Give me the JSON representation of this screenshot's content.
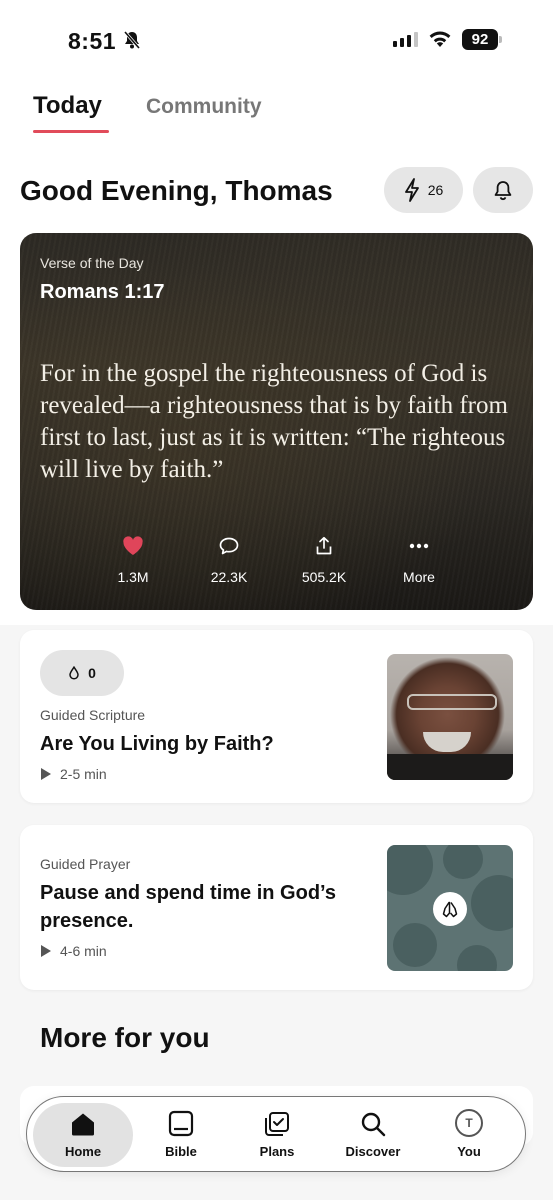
{
  "status_bar": {
    "time": "8:51",
    "battery": "92"
  },
  "tabs": [
    {
      "label": "Today",
      "active": true
    },
    {
      "label": "Community",
      "active": false
    }
  ],
  "greeting": "Good Evening, Thomas",
  "streak_count": "26",
  "verse": {
    "label": "Verse of the Day",
    "reference": "Romans 1:17",
    "text": "For in the gospel the righteousness of God is revealed—a righteousness that is by faith from first to last, just as it is written: “The righteous will live by faith.”",
    "actions": [
      {
        "icon": "heart-icon",
        "label": "1.3M"
      },
      {
        "icon": "comment-icon",
        "label": "22.3K"
      },
      {
        "icon": "share-icon",
        "label": "505.2K"
      },
      {
        "icon": "more-icon",
        "label": "More"
      }
    ]
  },
  "guided_scripture": {
    "count": "0",
    "kind": "Guided Scripture",
    "title": "Are You Living by Faith?",
    "duration": "2-5 min"
  },
  "guided_prayer": {
    "kind": "Guided Prayer",
    "title": "Pause and spend time in God’s presence.",
    "duration": "4-6 min"
  },
  "more_section_title": "More for you",
  "tabbar": [
    {
      "label": "Home",
      "icon": "home-icon",
      "active": true
    },
    {
      "label": "Bible",
      "icon": "bible-icon",
      "active": false
    },
    {
      "label": "Plans",
      "icon": "plans-icon",
      "active": false
    },
    {
      "label": "Discover",
      "icon": "search-icon",
      "active": false
    },
    {
      "label": "You",
      "icon": "avatar-icon",
      "avatar_initial": "T",
      "active": false
    }
  ],
  "colors": {
    "accent": "#e14b5a",
    "heart": "#e0455a",
    "pill_bg": "#e6e6e6"
  }
}
